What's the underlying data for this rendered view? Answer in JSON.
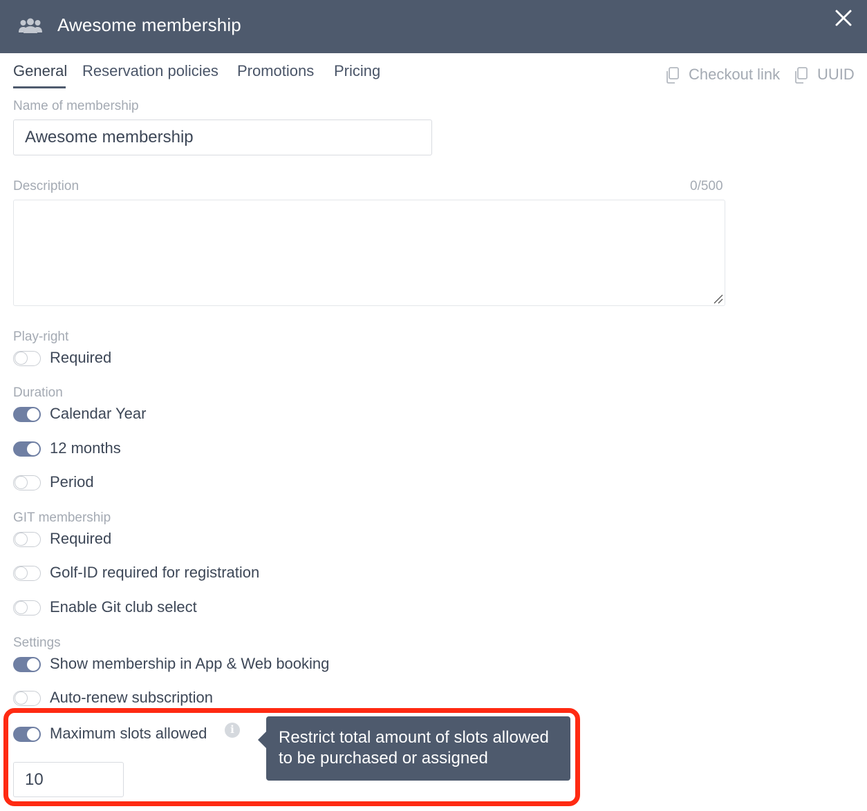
{
  "header": {
    "icon": "people-group-icon",
    "title": "Awesome membership",
    "close_icon": "close-icon",
    "bg_color": "#4e5a6d"
  },
  "tabs": [
    {
      "label": "General",
      "active": true
    },
    {
      "label": "Reservation policies",
      "active": false
    },
    {
      "label": "Promotions",
      "active": false
    },
    {
      "label": "Pricing",
      "active": false
    }
  ],
  "actions": {
    "checkout_link": "Checkout link",
    "uuid": "UUID",
    "icon": "copy-icon"
  },
  "form": {
    "name_label": "Name of membership",
    "name_value": "Awesome membership",
    "description_label": "Description",
    "description_value": "",
    "description_counter": "0/500",
    "play_right": {
      "label": "Play-right",
      "toggles": [
        {
          "label": "Required",
          "on": false
        }
      ]
    },
    "duration": {
      "label": "Duration",
      "toggles": [
        {
          "label": "Calendar Year",
          "on": true
        },
        {
          "label": "12 months",
          "on": true
        },
        {
          "label": "Period",
          "on": false
        }
      ]
    },
    "git_membership": {
      "label": "GIT membership",
      "toggles": [
        {
          "label": "Required",
          "on": false
        },
        {
          "label": "Golf-ID required for registration",
          "on": false
        },
        {
          "label": "Enable Git club select",
          "on": false
        }
      ]
    },
    "settings": {
      "label": "Settings",
      "toggles": [
        {
          "label": "Show membership in App & Web booking",
          "on": true
        },
        {
          "label": "Auto-renew subscription",
          "on": false
        },
        {
          "label": "Maximum slots allowed",
          "on": true
        }
      ],
      "max_slots_value": "10",
      "info_icon": "info-icon",
      "tooltip_line1": "Restrict total amount of slots allowed",
      "tooltip_line2": "to be purchased or assigned"
    }
  },
  "colors": {
    "toggle_on": "#6f7fa3",
    "highlight": "#ff2a12",
    "tooltip_bg": "#4e5a6d"
  }
}
